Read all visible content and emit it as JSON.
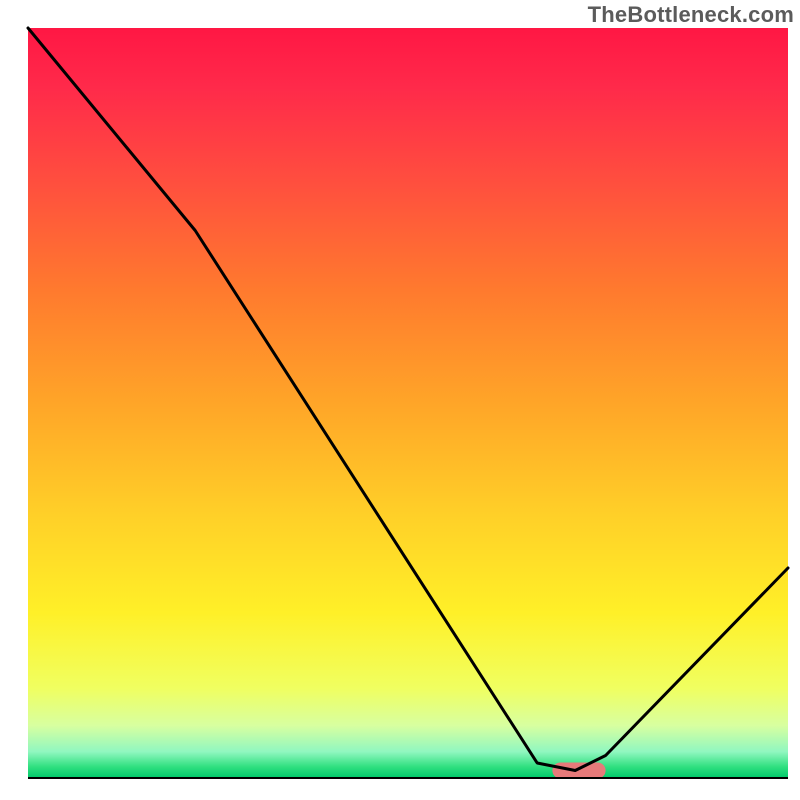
{
  "watermark": "TheBottleneck.com",
  "chart_data": {
    "type": "line",
    "title": "",
    "xlabel": "",
    "ylabel": "",
    "xlim": [
      0,
      100
    ],
    "ylim": [
      0,
      100
    ],
    "x": [
      0,
      22,
      67,
      72,
      76,
      100
    ],
    "values": [
      100,
      73,
      2,
      1,
      3,
      28
    ],
    "marker": {
      "x_range": [
        69,
        76
      ],
      "y": 1
    },
    "gradient_stops": [
      {
        "offset": 0.0,
        "color": "#ff1744"
      },
      {
        "offset": 0.08,
        "color": "#ff2a4a"
      },
      {
        "offset": 0.2,
        "color": "#ff4d3f"
      },
      {
        "offset": 0.35,
        "color": "#ff7a2e"
      },
      {
        "offset": 0.5,
        "color": "#ffa528"
      },
      {
        "offset": 0.65,
        "color": "#ffd028"
      },
      {
        "offset": 0.78,
        "color": "#fff028"
      },
      {
        "offset": 0.88,
        "color": "#f0ff60"
      },
      {
        "offset": 0.93,
        "color": "#d8ffa0"
      },
      {
        "offset": 0.965,
        "color": "#90f7c0"
      },
      {
        "offset": 0.985,
        "color": "#30e080"
      },
      {
        "offset": 1.0,
        "color": "#00c86a"
      }
    ],
    "frame_color": "#ffffff",
    "line_color": "#000000",
    "marker_color": "#e77a7a"
  }
}
